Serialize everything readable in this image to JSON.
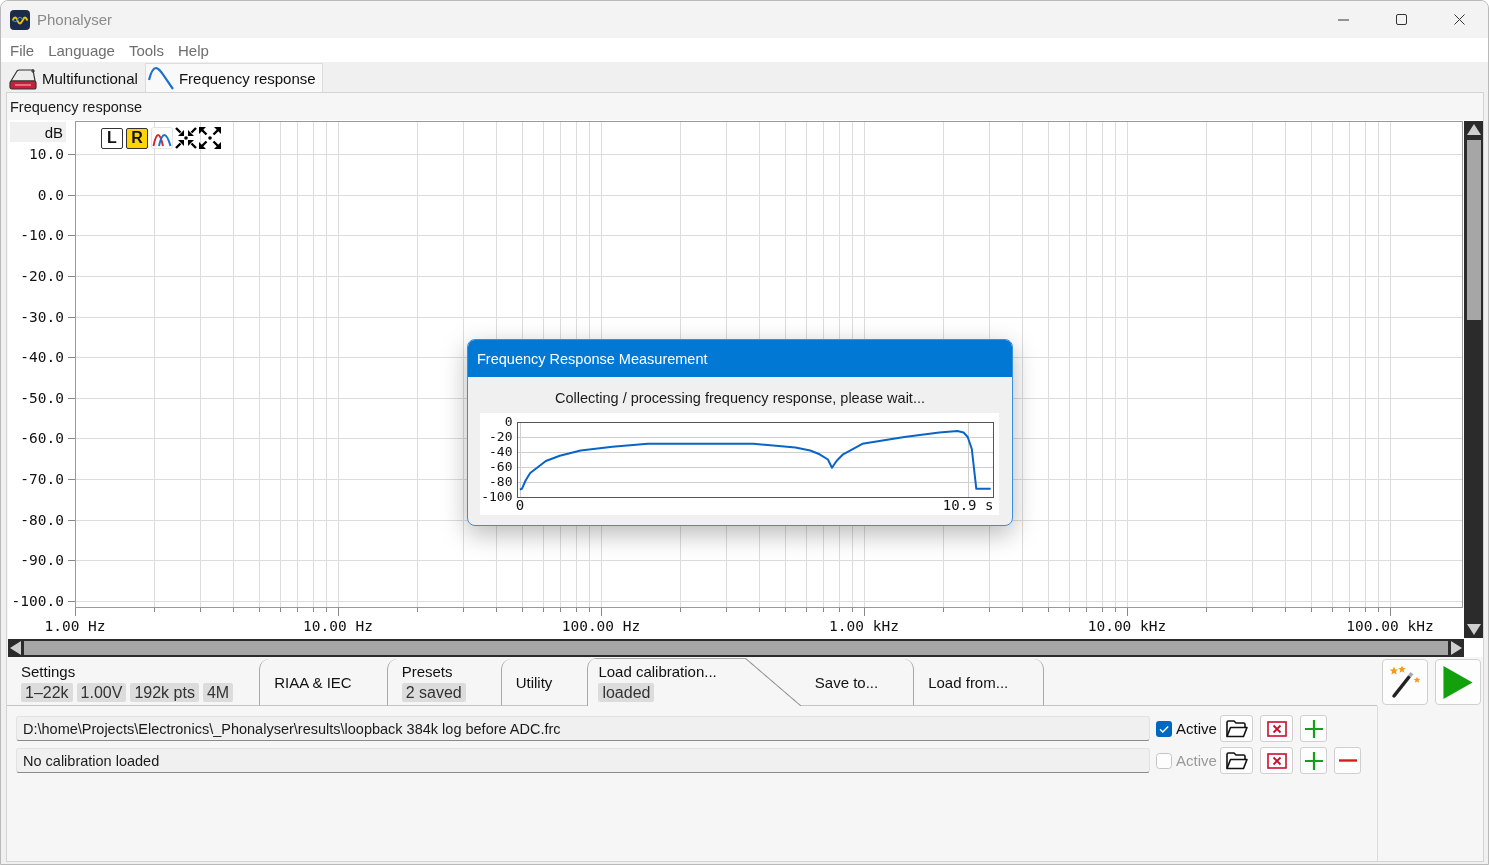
{
  "window": {
    "title": "Phonalyser"
  },
  "menu": [
    "File",
    "Language",
    "Tools",
    "Help"
  ],
  "tabs": [
    {
      "label": "Multifunctional",
      "selected": false
    },
    {
      "label": "Frequency response",
      "selected": true
    }
  ],
  "panel": {
    "title": "Frequency response",
    "channels": [
      {
        "label": "L",
        "selected": false
      },
      {
        "label": "R",
        "selected": true
      }
    ],
    "plot": {
      "y_unit": "dB",
      "y_labels": [
        "10.0",
        "0.0",
        "-10.0",
        "-20.0",
        "-30.0",
        "-40.0",
        "-50.0",
        "-60.0",
        "-70.0",
        "-80.0",
        "-90.0",
        "-100.0"
      ],
      "x_labels": [
        "1.00 Hz",
        "10.00 Hz",
        "100.00 Hz",
        "1.00 kHz",
        "10.00 kHz",
        "100.00 kHz"
      ]
    }
  },
  "bottom_tabs": [
    {
      "label": "Settings",
      "badges": [
        "1–22k",
        "1.00V",
        "192k pts",
        "4M"
      ],
      "selected": false
    },
    {
      "label": "RIAA & IEC",
      "selected": false
    },
    {
      "label": "Presets",
      "badges": [
        "2 saved"
      ],
      "selected": false
    },
    {
      "label": "Utility",
      "selected": false
    },
    {
      "label": "Load calibration...",
      "badges": [
        "loaded"
      ],
      "selected": true
    },
    {
      "label": "Save to...",
      "selected": false
    },
    {
      "label": "Load from...",
      "selected": false
    }
  ],
  "calibrations": [
    {
      "value": "D:\\home\\Projects\\Electronics\\_Phonalyser\\results\\loopback 384k log before ADC.frc",
      "checkbox_label": "Active",
      "active": true,
      "disabled": false,
      "buttons": [
        {
          "kind": "open"
        },
        {
          "kind": "clear"
        },
        {
          "kind": "add"
        }
      ]
    },
    {
      "value": "No calibration loaded",
      "checkbox_label": "Active",
      "active": false,
      "disabled": true,
      "buttons": [
        {
          "kind": "open"
        },
        {
          "kind": "clear"
        },
        {
          "kind": "add"
        },
        {
          "kind": "remove"
        }
      ]
    }
  ],
  "dialog": {
    "title": "Frequency Response Measurement",
    "message": "Collecting / processing frequency response, please wait...",
    "chart_data": {
      "type": "line",
      "grid": true,
      "xlim": [
        -0.07,
        11.53
      ],
      "ylim": [
        -100,
        0
      ],
      "xticks": [
        {
          "value": 0,
          "label": "0"
        },
        {
          "value": 10.9,
          "label": "10.9 s"
        }
      ],
      "yticks": [
        {
          "value": 0,
          "label": "0"
        },
        {
          "value": -20,
          "label": "-20"
        },
        {
          "value": -40,
          "label": "-40"
        },
        {
          "value": -60,
          "label": "-60"
        },
        {
          "value": -80,
          "label": "-80"
        },
        {
          "value": -100,
          "label": "-100"
        }
      ],
      "x": [
        0,
        0.05,
        0.14,
        0.25,
        0.42,
        0.63,
        0.97,
        1.48,
        2.25,
        3.11,
        5.68,
        6.7,
        7.06,
        7.29,
        7.49,
        7.59,
        7.7,
        7.86,
        8.33,
        9.35,
        10.2,
        10.64,
        10.79,
        10.89,
        10.99,
        11.1,
        11.45
      ],
      "series": [
        {
          "color": "#0a64c8",
          "values": [
            -90,
            -89,
            -78,
            -68,
            -61,
            -52,
            -45,
            -38,
            -33,
            -29,
            -29,
            -34,
            -38,
            -43,
            -50,
            -61,
            -52,
            -43,
            -29,
            -20,
            -14,
            -12,
            -14,
            -20,
            -36,
            -89,
            -89
          ]
        }
      ]
    }
  }
}
